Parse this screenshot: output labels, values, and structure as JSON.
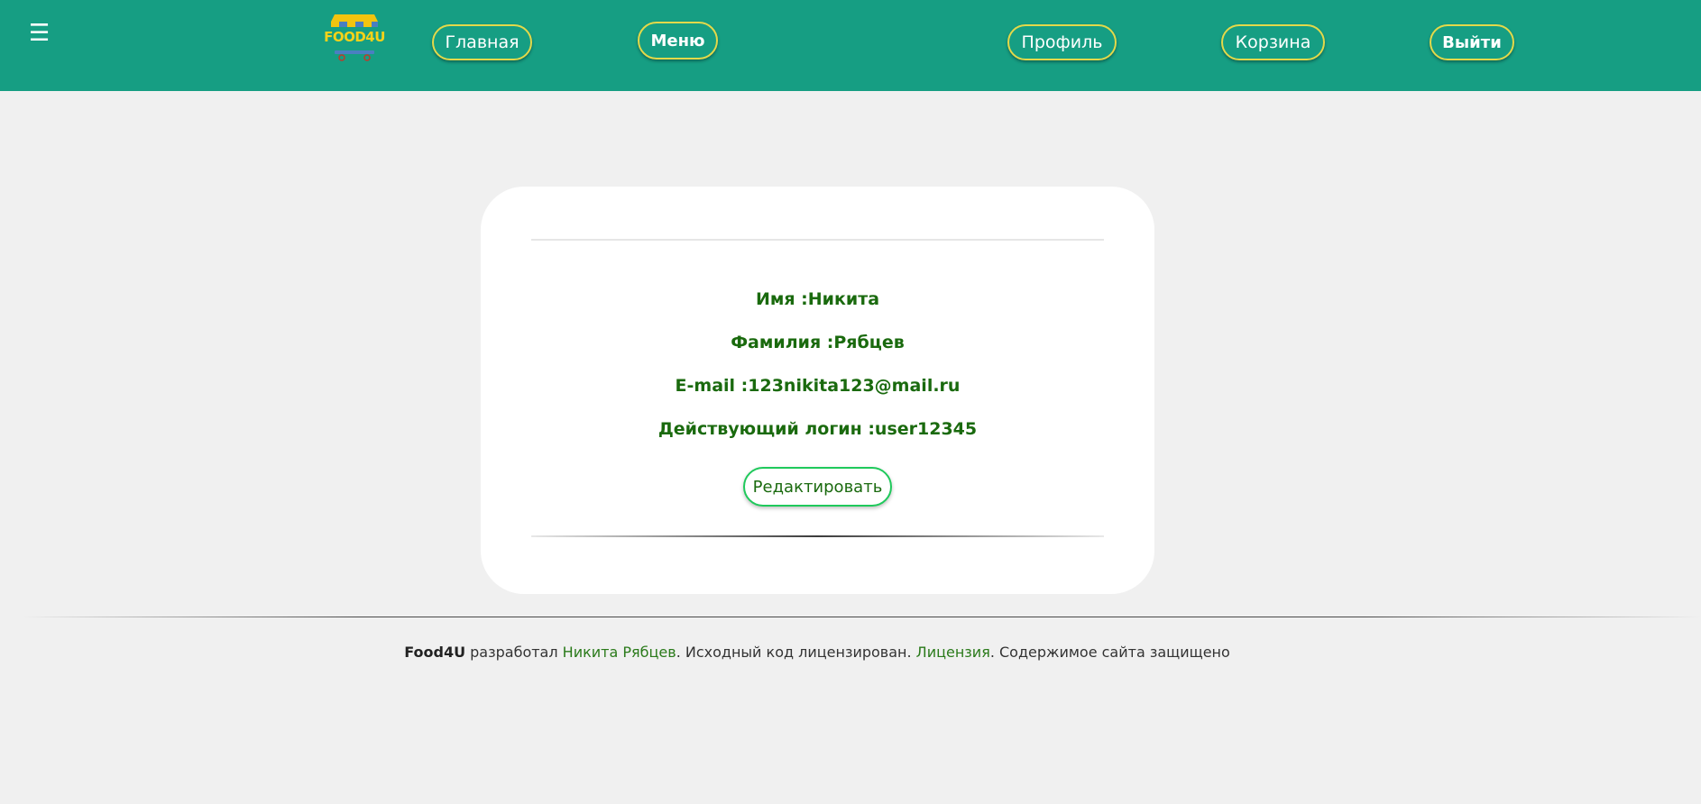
{
  "navbar": {
    "menu_icon": "☰",
    "logo_text": "FOOD4U",
    "links": {
      "home": "Главная",
      "menu": "Меню",
      "profile": "Профиль",
      "cart": "Корзина",
      "logout": "Выйти"
    },
    "colors": {
      "background": "#169e83",
      "button_border": "#e3d94a"
    }
  },
  "profile": {
    "name": "Имя :Никита",
    "surname": "Фамилия :Рябцев",
    "email": "E-mail :123nikita123@mail.ru",
    "login": "Действующий логин :user12345",
    "edit_button": "Редактировать",
    "text_color": "#1a6a0e"
  },
  "footer": {
    "brand": "Food4U",
    "developed_by": " разработал ",
    "author": "Никита Рябцев",
    "source_text": ". Исходный код лицензирован. ",
    "license": "Лицензия",
    "rights": ". Содержимое сайта защищено"
  }
}
